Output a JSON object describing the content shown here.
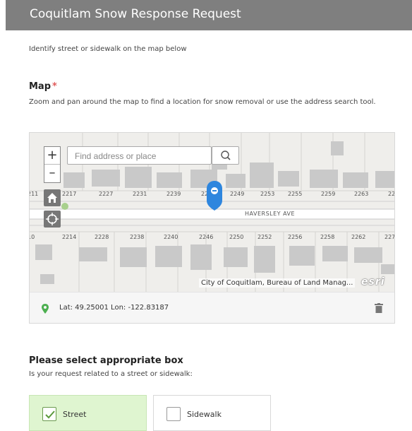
{
  "header": {
    "title": "Coquitlam Snow Response Request"
  },
  "intro": {
    "text": "Identify street or sidewalk on the map below"
  },
  "map_section": {
    "label": "Map",
    "required_mark": "*",
    "help": "Zoom and pan around the map to find a location for snow removal or use the address search tool."
  },
  "map": {
    "search": {
      "placeholder": "Find address or place",
      "value": ""
    },
    "zoom_in": "+",
    "zoom_out": "–",
    "street_name": "HAVERSLEY AVE",
    "addresses_north": [
      "211",
      "2217",
      "2227",
      "2231",
      "2239",
      "22",
      "2249",
      "2253",
      "2255",
      "2259",
      "2263",
      "22"
    ],
    "addresses_south": [
      "10",
      "2214",
      "2228",
      "2238",
      "2240",
      "2246",
      "2250",
      "2252",
      "2256",
      "2258",
      "2262",
      "227"
    ],
    "attribution": "City of Coquitlam, Bureau of Land Manag...",
    "esri_logo": "esri",
    "coords": "Lat: 49.25001 Lon: -122.83187"
  },
  "select_section": {
    "title": "Please select appropriate box",
    "help": "Is your request related to a street or sidewalk:",
    "options": [
      {
        "label": "Street",
        "checked": true
      },
      {
        "label": "Sidewalk",
        "checked": false
      }
    ]
  },
  "colors": {
    "header_bg": "#7f7f7f",
    "required": "#e05a5a",
    "accent_blue": "#2e86de",
    "pin_green": "#4caf50",
    "selected_bg": "#dff5d0"
  }
}
